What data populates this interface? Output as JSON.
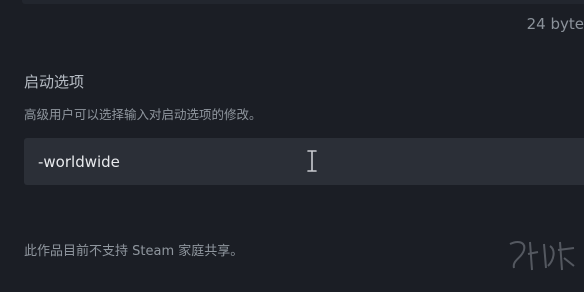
{
  "header": {
    "file_size": "24 byte"
  },
  "launch_options": {
    "title": "启动选项",
    "description": "高级用户可以选择输入对启动选项的修改。",
    "value": "-worldwide",
    "placeholder": ""
  },
  "family_sharing": {
    "note": "此作品目前不支持 Steam 家庭共享。"
  },
  "watermark": {
    "text": "游侠网"
  },
  "icons": {
    "cursor": "text-cursor-icon"
  },
  "colors": {
    "background": "#1b1e25",
    "input_bg": "#2b2f37",
    "title_text": "#b6bcc4",
    "muted_text": "#8f969e"
  }
}
